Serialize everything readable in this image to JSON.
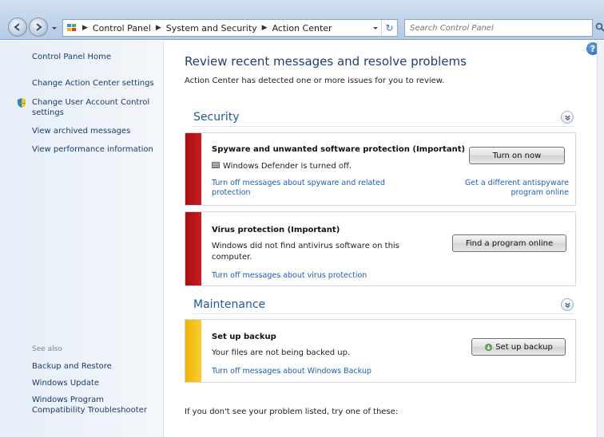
{
  "address_bar": {
    "crumbs": [
      "Control Panel",
      "System and Security",
      "Action Center"
    ],
    "search_placeholder": "Search Control Panel"
  },
  "left_pane": {
    "home": "Control Panel Home",
    "links": [
      "Change Action Center settings",
      "Change User Account Control settings",
      "View archived messages",
      "View performance information"
    ],
    "see_also_label": "See also",
    "see_also": [
      "Backup and Restore",
      "Windows Update",
      "Windows Program Compatibility Troubleshooter"
    ]
  },
  "main": {
    "title": "Review recent messages and resolve problems",
    "subtitle": "Action Center has detected one or more issues for you to review.",
    "security": {
      "header": "Security",
      "spyware": {
        "title": "Spyware and unwanted software protection  (Important)",
        "desc": "Windows Defender is turned off.",
        "link_off": "Turn off messages about spyware and related protection",
        "button": "Turn on now",
        "link_alt": "Get a different antispyware program online"
      },
      "virus": {
        "title": "Virus protection  (Important)",
        "desc": "Windows did not find antivirus software on this computer.",
        "link_off": "Turn off messages about virus protection",
        "button": "Find a program online"
      }
    },
    "maintenance": {
      "header": "Maintenance",
      "backup": {
        "title": "Set up backup",
        "desc": "Your files are not being backed up.",
        "link_off": "Turn off messages about Windows Backup",
        "button": "Set up backup"
      }
    },
    "footer": "If you don't see your problem listed, try one of these:"
  },
  "colors": {
    "critical_bar": "#b3141a",
    "warning_bar": "#f3c012",
    "link": "#1f5fb4",
    "title": "#1e3f73"
  },
  "icons": {
    "back": "back-arrow-icon",
    "forward": "forward-arrow-icon",
    "refresh": "refresh-icon",
    "search": "search-icon",
    "help": "help-icon",
    "uac_shield": "uac-shield-icon",
    "collapse": "chevron-collapse-icon"
  }
}
